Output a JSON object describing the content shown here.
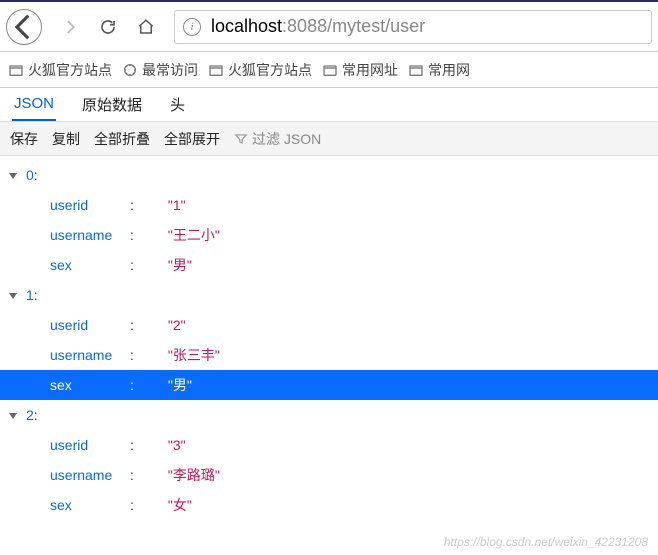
{
  "url": {
    "prefix": "localhost",
    "port": ":8088",
    "path": "/mytest/user"
  },
  "bookmarks": [
    "火狐官方站点",
    "最常访问",
    "火狐官方站点",
    "常用网址",
    "常用网"
  ],
  "tabs": [
    "JSON",
    "原始数据",
    "头"
  ],
  "actions": {
    "save": "保存",
    "copy": "复制",
    "collapse": "全部折叠",
    "expand": "全部展开",
    "filter": "过滤 JSON"
  },
  "chart_data": {
    "type": "table",
    "columns": [
      "userid",
      "username",
      "sex"
    ],
    "rows": [
      {
        "userid": "1",
        "username": "王二小",
        "sex": "男"
      },
      {
        "userid": "2",
        "username": "张三丰",
        "sex": "男"
      },
      {
        "userid": "3",
        "username": "李路璐",
        "sex": "女"
      }
    ]
  },
  "watermark": "https://blog.csdn.net/weixin_42231208"
}
